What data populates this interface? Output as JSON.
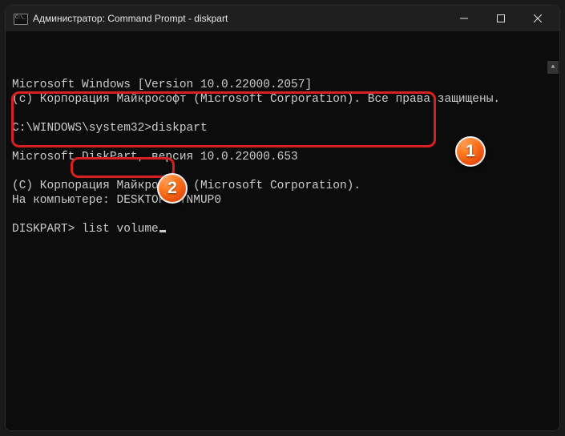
{
  "titlebar": {
    "title": "Администратор: Command Prompt - diskpart"
  },
  "console": {
    "line1": "Microsoft Windows [Version 10.0.22000.2057]",
    "line2": "(c) Корпорация Майкрософт (Microsoft Corporation). Все права защищены.",
    "blank1": "",
    "prompt_path": "C:\\WINDOWS\\system32>",
    "prompt_cmd": "diskpart",
    "blank2": "",
    "dp_version": "Microsoft DiskPart, версия 10.0.22000.653",
    "blank3": "",
    "dp_copyright": "(C) Корпорация Майкрософт (Microsoft Corporation).",
    "dp_computer": "На компьютере: DESKTOP-VTNMUP0",
    "blank4": "",
    "dp_prompt": "DISKPART> ",
    "dp_input": "list volume"
  },
  "badges": {
    "one": "1",
    "two": "2"
  }
}
